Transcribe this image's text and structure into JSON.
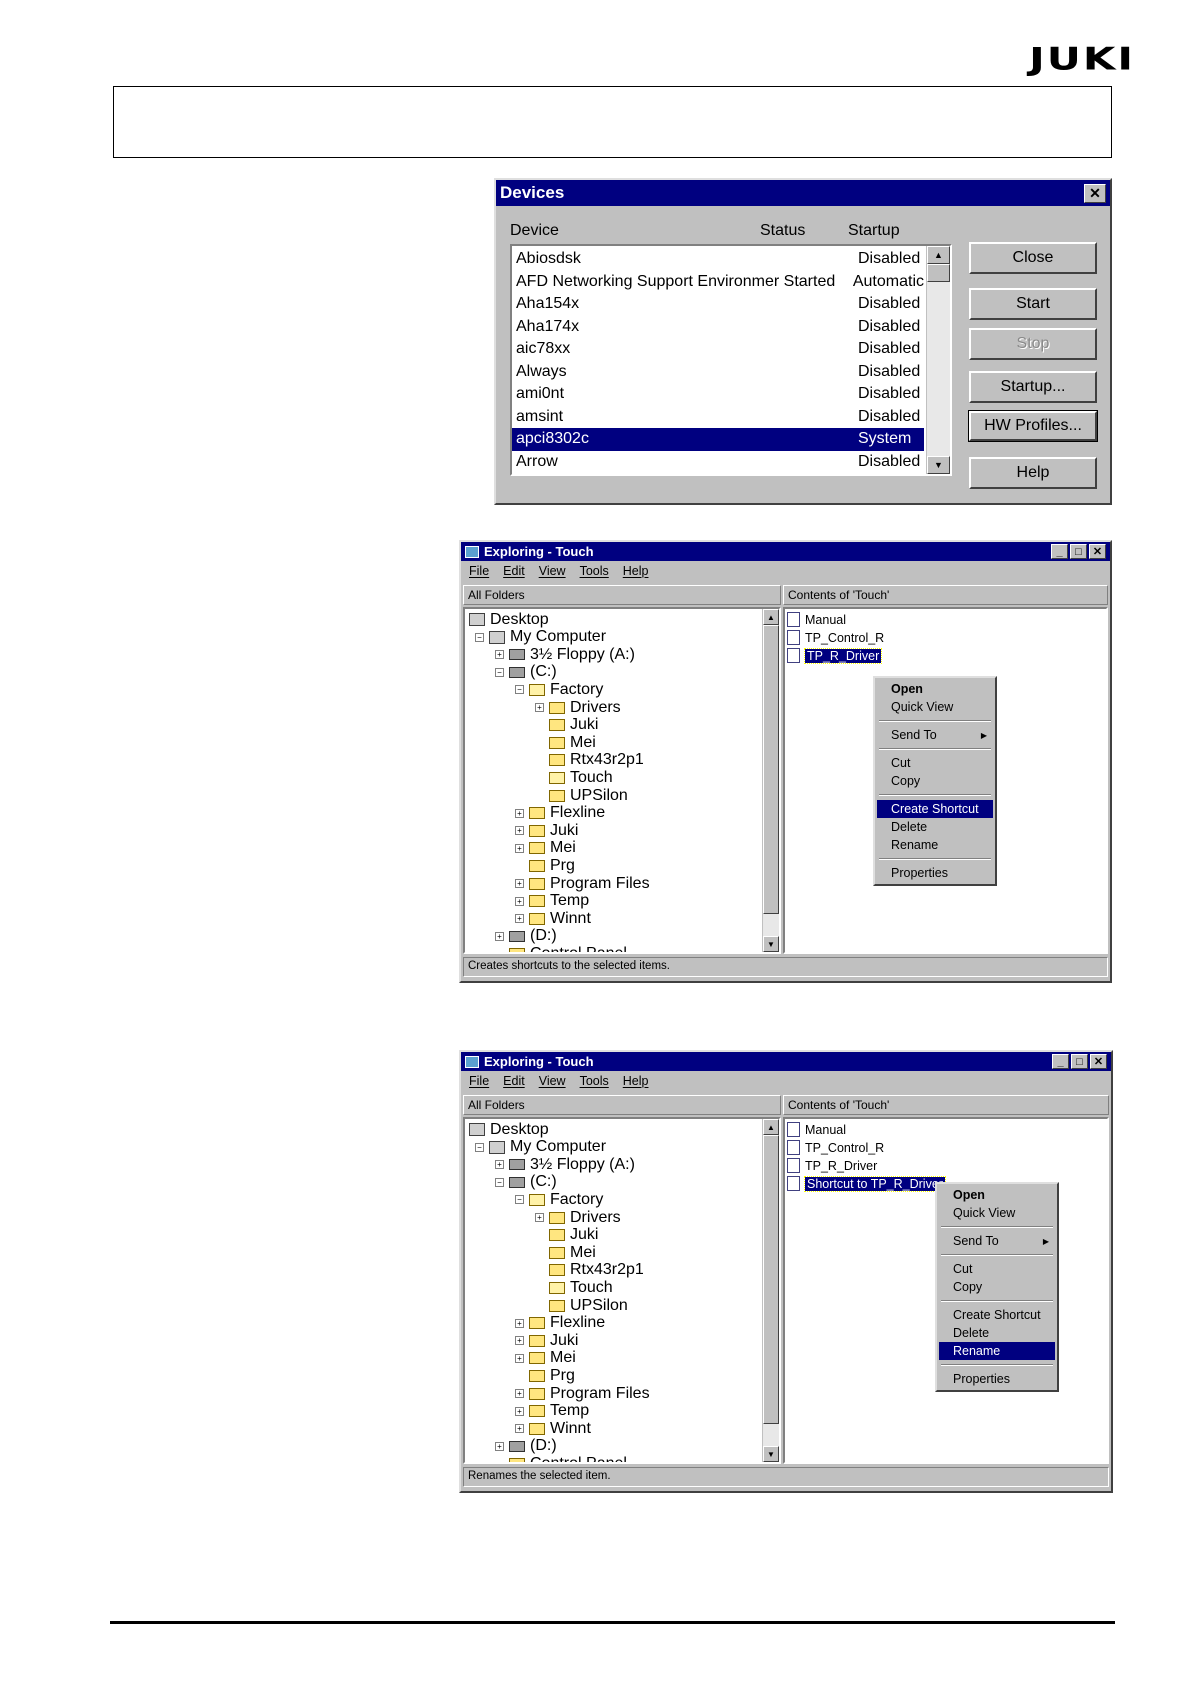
{
  "logo": {
    "text": "JUKI"
  },
  "devices": {
    "title": "Devices",
    "headers": {
      "device": "Device",
      "status": "Status",
      "startup": "Startup"
    },
    "rows": [
      {
        "name": "Abiosdsk",
        "startup": "Disabled"
      },
      {
        "name": "AFD Networking Support Environmer Started",
        "startup": "Automatic"
      },
      {
        "name": "Aha154x",
        "startup": "Disabled"
      },
      {
        "name": "Aha174x",
        "startup": "Disabled"
      },
      {
        "name": "aic78xx",
        "startup": "Disabled"
      },
      {
        "name": "Always",
        "startup": "Disabled"
      },
      {
        "name": "ami0nt",
        "startup": "Disabled"
      },
      {
        "name": "amsint",
        "startup": "Disabled"
      },
      {
        "name": "apci8302c",
        "startup": "System"
      },
      {
        "name": "Arrow",
        "startup": "Disabled"
      }
    ],
    "buttons": {
      "close": "Close",
      "start": "Start",
      "stop": "Stop",
      "startup": "Startup...",
      "hwprofiles": "HW Profiles...",
      "help": "Help"
    }
  },
  "explorer1": {
    "title": "Exploring - Touch",
    "menu": [
      "File",
      "Edit",
      "View",
      "Tools",
      "Help"
    ],
    "all_folders": "All Folders",
    "contents_title": "Contents of 'Touch'",
    "tree": [
      "Desktop",
      "My Computer",
      "3½ Floppy (A:)",
      "(C:)",
      "Factory",
      "Drivers",
      "Juki",
      "Mei",
      "Rtx43r2p1",
      "Touch",
      "UPSilon",
      "Flexline",
      "Juki",
      "Mei",
      "Prg",
      "Program Files",
      "Temp",
      "Winnt",
      "(D:)",
      "Control Panel"
    ],
    "files": [
      "Manual",
      "TP_Control_R",
      "TP_R_Driver"
    ],
    "context_menu": [
      "Open",
      "Quick View",
      "Send To",
      "Cut",
      "Copy",
      "Create Shortcut",
      "Delete",
      "Rename",
      "Properties"
    ],
    "status": "Creates shortcuts to the selected items."
  },
  "explorer2": {
    "title": "Exploring - Touch",
    "menu": [
      "File",
      "Edit",
      "View",
      "Tools",
      "Help"
    ],
    "all_folders": "All Folders",
    "contents_title": "Contents of 'Touch'",
    "tree": [
      "Desktop",
      "My Computer",
      "3½ Floppy (A:)",
      "(C:)",
      "Factory",
      "Drivers",
      "Juki",
      "Mei",
      "Rtx43r2p1",
      "Touch",
      "UPSilon",
      "Flexline",
      "Juki",
      "Mei",
      "Prg",
      "Program Files",
      "Temp",
      "Winnt",
      "(D:)",
      "Control Panel"
    ],
    "files": [
      "Manual",
      "TP_Control_R",
      "TP_R_Driver",
      "Shortcut to TP_R_Driver"
    ],
    "context_menu": [
      "Open",
      "Quick View",
      "Send To",
      "Cut",
      "Copy",
      "Create Shortcut",
      "Delete",
      "Rename",
      "Properties"
    ],
    "status": "Renames the selected item."
  }
}
